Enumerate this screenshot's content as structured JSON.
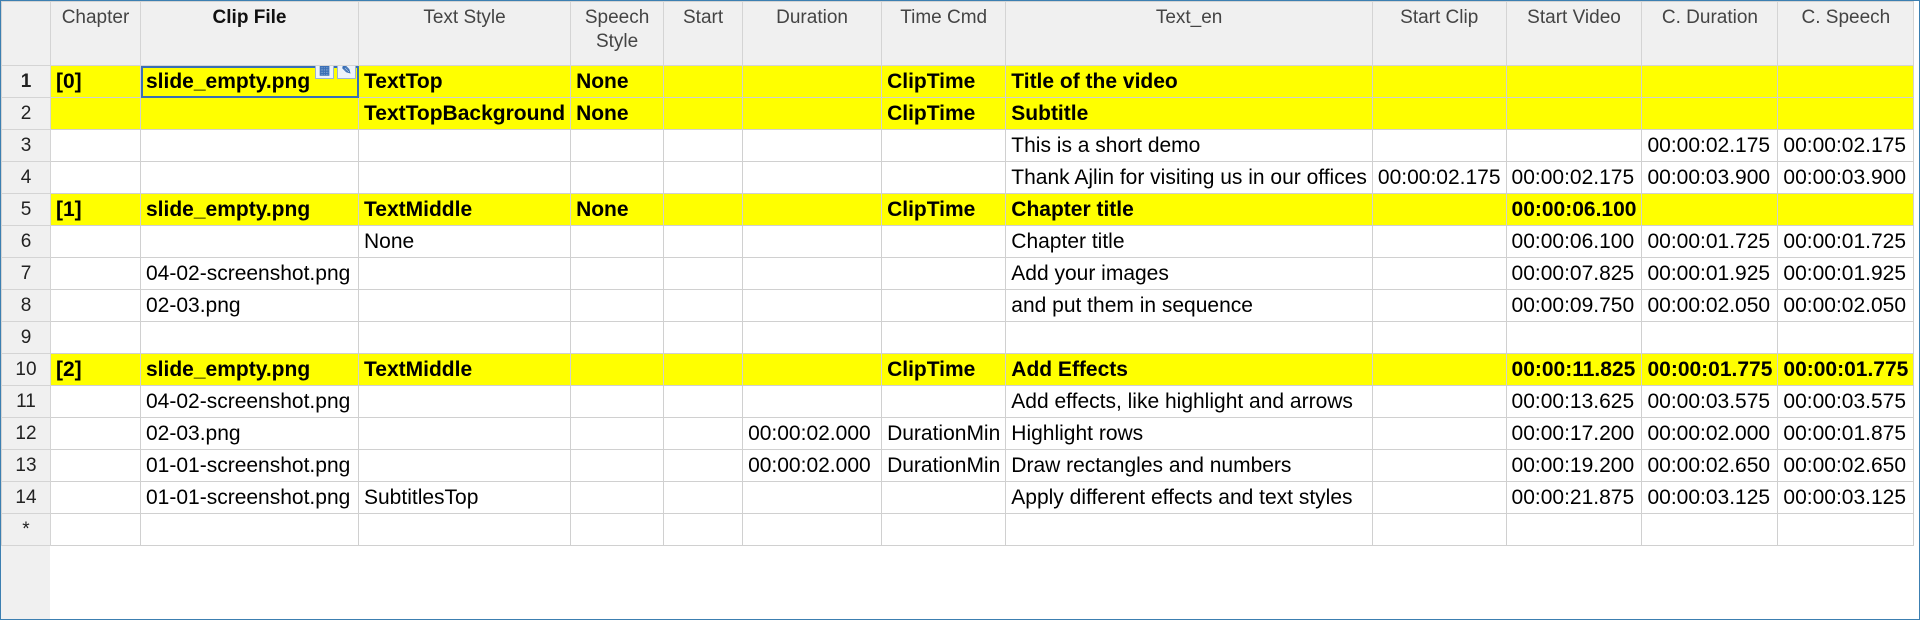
{
  "columns": [
    "Chapter",
    "Clip File",
    "Text Style",
    "Speech\nStyle",
    "Start",
    "Duration",
    "Time Cmd",
    "Text_en",
    "Start Clip",
    "Start Video",
    "C. Duration",
    "C. Speech"
  ],
  "sorted_column": "Clip File",
  "highlight_color": "#ffff00",
  "selected_cell": {
    "row": 1,
    "column": "Clip File"
  },
  "new_row_marker": "*",
  "rows": [
    {
      "num": "1",
      "highlight": true,
      "cells": [
        "[0]",
        "slide_empty.png",
        "TextTop",
        "None",
        "",
        "",
        "ClipTime",
        "Title of the video",
        "",
        "",
        "",
        ""
      ]
    },
    {
      "num": "2",
      "highlight": true,
      "cells": [
        "",
        "",
        "TextTopBackground",
        "None",
        "",
        "",
        "ClipTime",
        "Subtitle",
        "",
        "",
        "",
        ""
      ]
    },
    {
      "num": "3",
      "highlight": false,
      "cells": [
        "",
        "",
        "",
        "",
        "",
        "",
        "",
        "This is a short demo",
        "",
        "",
        "00:00:02.175",
        "00:00:02.175"
      ]
    },
    {
      "num": "4",
      "highlight": false,
      "cells": [
        "",
        "",
        "",
        "",
        "",
        "",
        "",
        "Thank Ajlin for visiting us in our offices",
        "00:00:02.175",
        "00:00:02.175",
        "00:00:03.900",
        "00:00:03.900"
      ]
    },
    {
      "num": "5",
      "highlight": true,
      "cells": [
        "[1]",
        "slide_empty.png",
        "TextMiddle",
        "None",
        "",
        "",
        "ClipTime",
        "Chapter title",
        "",
        "00:00:06.100",
        "",
        ""
      ]
    },
    {
      "num": "6",
      "highlight": false,
      "cells": [
        "",
        "",
        "None",
        "",
        "",
        "",
        "",
        "Chapter title",
        "",
        "00:00:06.100",
        "00:00:01.725",
        "00:00:01.725"
      ]
    },
    {
      "num": "7",
      "highlight": false,
      "cells": [
        "",
        "04-02-screenshot.png",
        "",
        "",
        "",
        "",
        "",
        "Add your images",
        "",
        "00:00:07.825",
        "00:00:01.925",
        "00:00:01.925"
      ]
    },
    {
      "num": "8",
      "highlight": false,
      "cells": [
        "",
        "02-03.png",
        "",
        "",
        "",
        "",
        "",
        "and put them in sequence",
        "",
        "00:00:09.750",
        "00:00:02.050",
        "00:00:02.050"
      ]
    },
    {
      "num": "9",
      "highlight": false,
      "cells": [
        "",
        "",
        "",
        "",
        "",
        "",
        "",
        "",
        "",
        "",
        "",
        ""
      ]
    },
    {
      "num": "10",
      "highlight": true,
      "cells": [
        "[2]",
        "slide_empty.png",
        "TextMiddle",
        "",
        "",
        "",
        "ClipTime",
        "Add Effects",
        "",
        "00:00:11.825",
        "00:00:01.775",
        "00:00:01.775"
      ]
    },
    {
      "num": "11",
      "highlight": false,
      "cells": [
        "",
        "04-02-screenshot.png",
        "",
        "",
        "",
        "",
        "",
        "Add  effects, like highlight and arrows",
        "",
        "00:00:13.625",
        "00:00:03.575",
        "00:00:03.575"
      ]
    },
    {
      "num": "12",
      "highlight": false,
      "cells": [
        "",
        "02-03.png",
        "",
        "",
        "",
        "00:00:02.000",
        "DurationMin",
        "Highlight rows",
        "",
        "00:00:17.200",
        "00:00:02.000",
        "00:00:01.875"
      ]
    },
    {
      "num": "13",
      "highlight": false,
      "cells": [
        "",
        "01-01-screenshot.png",
        "",
        "",
        "",
        "00:00:02.000",
        "DurationMin",
        "Draw rectangles and numbers",
        "",
        "00:00:19.200",
        "00:00:02.650",
        "00:00:02.650"
      ]
    },
    {
      "num": "14",
      "highlight": false,
      "cells": [
        "",
        "01-01-screenshot.png",
        "SubtitlesTop",
        "",
        "",
        "",
        "",
        "Apply different effects and text styles",
        "",
        "00:00:21.875",
        "00:00:03.125",
        "00:00:03.125"
      ]
    }
  ]
}
